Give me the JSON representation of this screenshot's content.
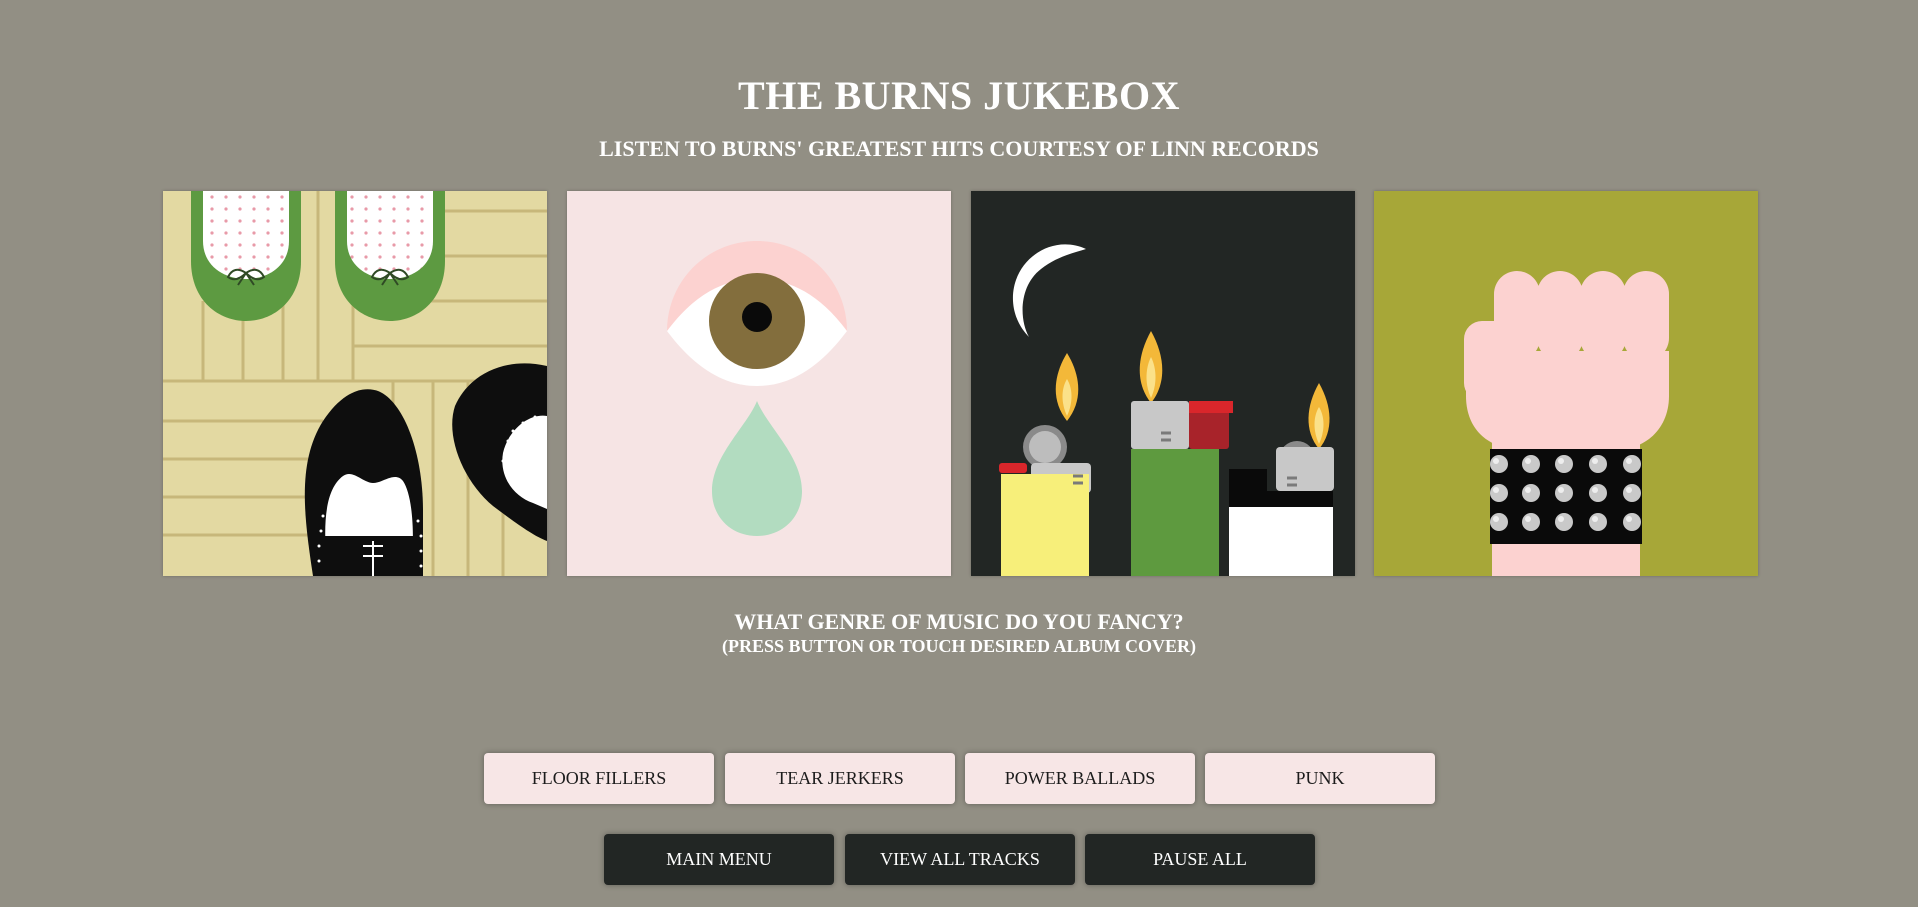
{
  "header": {
    "title": "THE BURNS JUKEBOX",
    "subtitle": "LISTEN TO BURNS' GREATEST HITS COURTESY OF LINN RECORDS"
  },
  "covers": [
    {
      "genre": "floor-fillers",
      "icon": "dancing-shoes-illustration",
      "background": "#e3d9a2"
    },
    {
      "genre": "tear-jerkers",
      "icon": "crying-eye-illustration",
      "background": "#f6e4e4"
    },
    {
      "genre": "power-ballads",
      "icon": "lighters-illustration",
      "background": "#222624"
    },
    {
      "genre": "punk",
      "icon": "studded-fist-illustration",
      "background": "#a7a738"
    }
  ],
  "prompt": {
    "question": "WHAT GENRE OF MUSIC DO YOU FANCY?",
    "instruction": "(PRESS BUTTON OR TOUCH DESIRED ALBUM COVER)"
  },
  "genre_buttons": {
    "floor_fillers": "FLOOR FILLERS",
    "tear_jerkers": "TEAR JERKERS",
    "power_ballads": "POWER BALLADS",
    "punk": "PUNK"
  },
  "nav_buttons": {
    "main_menu": "MAIN MENU",
    "view_all_tracks": "VIEW ALL TRACKS",
    "pause_all": "PAUSE ALL"
  },
  "colors": {
    "page_background": "#928f84",
    "genre_button_bg": "#f7e6e6",
    "nav_button_bg": "#222624",
    "heading_text": "#ffffff"
  }
}
